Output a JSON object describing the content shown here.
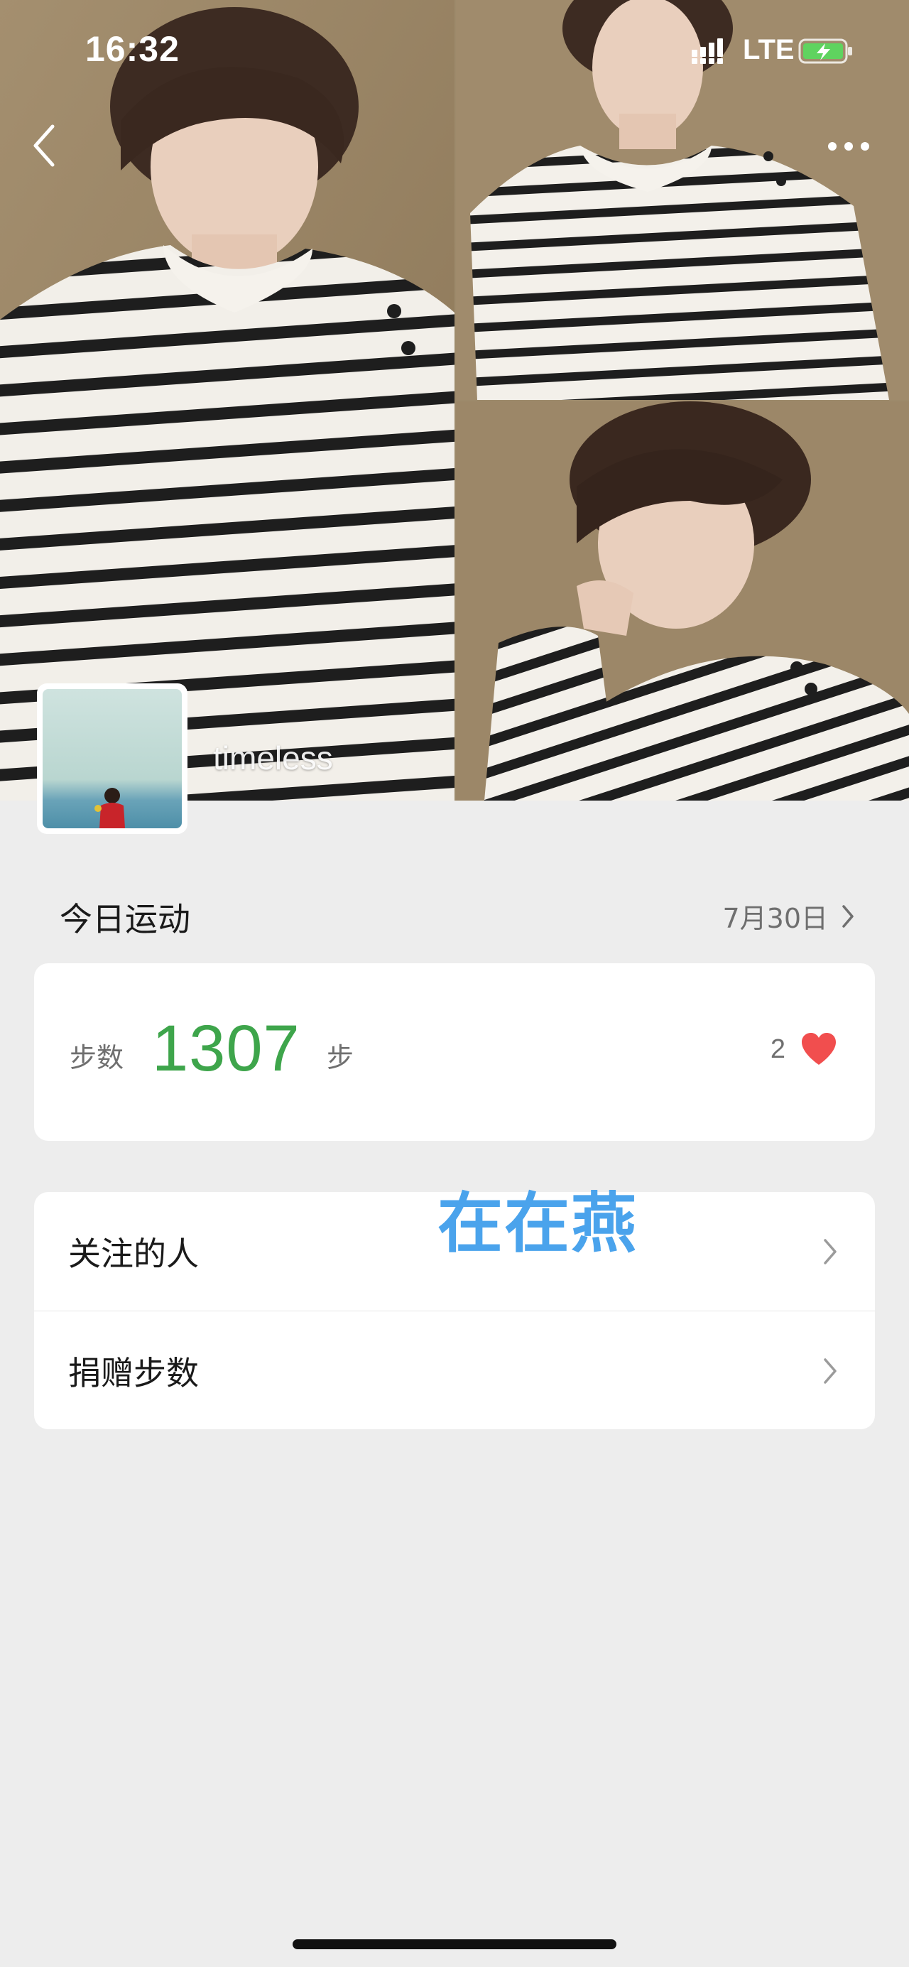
{
  "status_bar": {
    "time": "16:32",
    "network": "LTE",
    "signal_icon": "signal-bars-icon",
    "battery_icon": "battery-charging-icon"
  },
  "nav": {
    "back_icon": "chevron-left-icon",
    "more_icon": "more-dots-icon"
  },
  "profile": {
    "nickname": "timeless"
  },
  "today": {
    "title": "今日运动",
    "date": "7月30日"
  },
  "steps": {
    "label": "步数",
    "value": "1307",
    "unit": "步",
    "likes": "2",
    "value_color": "#3ea54b",
    "heart_color": "#f14e4e"
  },
  "menu": {
    "items": [
      {
        "label": "关注的人"
      },
      {
        "label": "捐赠步数"
      }
    ]
  },
  "watermark": {
    "text": "在在燕",
    "color": "#4aa3ec"
  }
}
